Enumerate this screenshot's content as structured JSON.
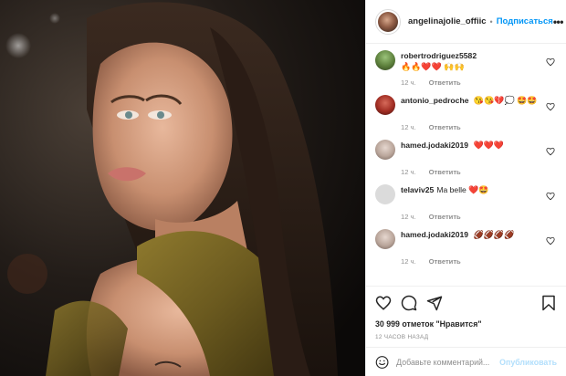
{
  "header": {
    "username": "angelinajolie_offiic",
    "dot": "•",
    "follow_label": "Подписаться",
    "more_label": "•••"
  },
  "comments": [
    {
      "user": "robertrodriguez5582",
      "text": "",
      "emoji": "🔥🔥❤️❤️ 🙌🙌",
      "time": "12 ч.",
      "reply": "Ответить"
    },
    {
      "user": "antonio_pedroche",
      "text": "",
      "emoji": "😘😘💔💭 🤩🤩",
      "time": "12 ч.",
      "reply": "Ответить"
    },
    {
      "user": "hamed.jodaki2019",
      "text": "",
      "emoji": "❤️❤️❤️",
      "time": "12 ч.",
      "reply": "Ответить"
    },
    {
      "user": "telaviv25",
      "text": "Ma belle",
      "emoji": "❤️🤩",
      "time": "12 ч.",
      "reply": "Ответить"
    },
    {
      "user": "hamed.jodaki2019",
      "text": "",
      "emoji": "🏈🏈🏈🏈",
      "time": "12 ч.",
      "reply": "Ответить"
    }
  ],
  "actions": {
    "likes": "30 999 отметок \"Нравится\"",
    "time_ago": "12 ЧАСОВ НАЗАД"
  },
  "add_comment": {
    "placeholder": "Добавьте комментарий...",
    "publish_label": "Опубликовать"
  },
  "colors": {
    "accent": "#0095f6",
    "publish_disabled": "#b2dffc",
    "muted": "#8e8e8e",
    "border": "#efefef"
  },
  "icons": [
    "more-icon",
    "heart-icon",
    "comment-icon",
    "share-icon",
    "bookmark-icon",
    "smile-icon"
  ]
}
